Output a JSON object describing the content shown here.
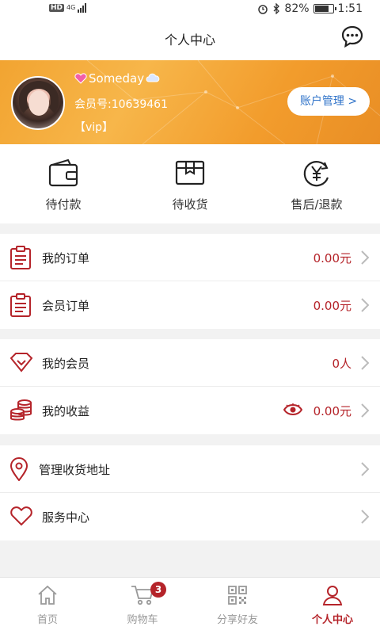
{
  "status_bar": {
    "left_badge": "HD",
    "network": "4G",
    "battery": "82%",
    "battery_level": 0.82,
    "time": "1:51"
  },
  "header": {
    "title": "个人中心",
    "chat_icon": "chat-bubble-icon"
  },
  "profile": {
    "nickname": "Someday",
    "member_no": "会员号:10639461",
    "level": "【vip】",
    "account_button": "账户管理 >",
    "background_color": "#f2a431"
  },
  "order_tabs": [
    {
      "label": "待付款",
      "icon": "wallet-icon"
    },
    {
      "label": "待收货",
      "icon": "package-icon"
    },
    {
      "label": "售后/退款",
      "icon": "yuan-refresh-icon"
    }
  ],
  "menu": {
    "orders": [
      {
        "label": "我的订单",
        "value": "0.00元",
        "icon": "clipboard-icon"
      },
      {
        "label": "会员订单",
        "value": "0.00元",
        "icon": "clipboard-icon"
      }
    ],
    "members": [
      {
        "label": "我的会员",
        "value": "0人",
        "icon": "diamond-icon"
      },
      {
        "label": "我的收益",
        "value": "0.00元",
        "icon": "coins-icon"
      }
    ],
    "service": [
      {
        "label": "管理收货地址",
        "icon": "location-pin-icon"
      },
      {
        "label": "服务中心",
        "icon": "heart-icon"
      }
    ]
  },
  "tabbar": [
    {
      "label": "首页",
      "icon": "home-icon",
      "active": false
    },
    {
      "label": "购物车",
      "icon": "cart-icon",
      "badge": "3",
      "active": false
    },
    {
      "label": "分享好友",
      "icon": "qr-code-icon",
      "active": false
    },
    {
      "label": "个人中心",
      "icon": "person-icon",
      "active": true
    }
  ],
  "colors": {
    "accent": "#b5242a",
    "link": "#2f73c9",
    "banner": "#f2a431"
  }
}
